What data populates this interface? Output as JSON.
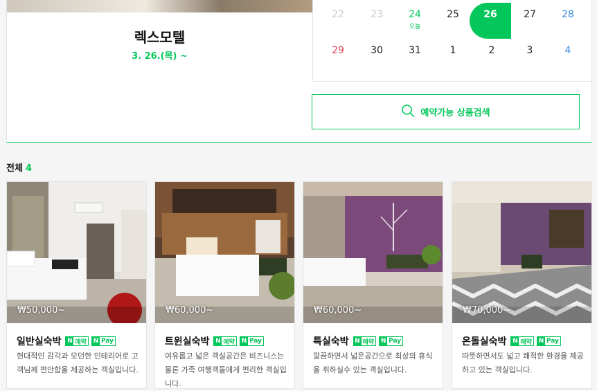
{
  "hotel": {
    "name": "렉스모텔",
    "date": "3. 26.(목) ~"
  },
  "calendar": {
    "row1": [
      {
        "d": "22",
        "cls": "dim",
        "sub": ""
      },
      {
        "d": "23",
        "cls": "dim",
        "sub": ""
      },
      {
        "d": "24",
        "cls": "today",
        "sub": "오늘"
      },
      {
        "d": "25",
        "cls": "",
        "sub": ""
      },
      {
        "d": "26",
        "cls": "sel",
        "sub": ""
      },
      {
        "d": "27",
        "cls": "",
        "sub": ""
      },
      {
        "d": "28",
        "cls": "sat",
        "sub": ""
      }
    ],
    "row2": [
      {
        "d": "29",
        "cls": "sun",
        "sub": ""
      },
      {
        "d": "30",
        "cls": "",
        "sub": ""
      },
      {
        "d": "31",
        "cls": "",
        "sub": ""
      },
      {
        "d": "1",
        "cls": "",
        "sub": ""
      },
      {
        "d": "2",
        "cls": "",
        "sub": ""
      },
      {
        "d": "3",
        "cls": "",
        "sub": ""
      },
      {
        "d": "4",
        "cls": "sat",
        "sub": ""
      }
    ]
  },
  "search_button": {
    "label": "예약가능 상품검색"
  },
  "list_header": {
    "label": "전체",
    "count": "4"
  },
  "badges": {
    "reserve": "예약",
    "pay": "Pay",
    "n": "N"
  },
  "rooms": [
    {
      "name": "일반실숙박",
      "price": "₩50,000~",
      "desc": "현대적인 감각과 모던한 인테리어로 고객님께 편안함을 제공하는 객실입니다."
    },
    {
      "name": "트윈실숙박",
      "price": "₩60,000~",
      "desc": "여유롭고 넓은 객실공간은 비즈니스는 물론 가족 여행객들에게 편리한 객실입니다."
    },
    {
      "name": "특실숙박",
      "price": "₩60,000~",
      "desc": "깔끔하면서 넓은공간으로 최상의 휴식을 취하실수 있는 객실입니다."
    },
    {
      "name": "온돌실숙박",
      "price": "₩70,000~",
      "desc": "따뜻하면서도 넓고 쾌적한 환경을 제공하고 있는 객실입니다."
    }
  ],
  "colors": {
    "accent": "#03c75a",
    "sunday": "#e0435a",
    "saturday": "#3a8ee0"
  }
}
